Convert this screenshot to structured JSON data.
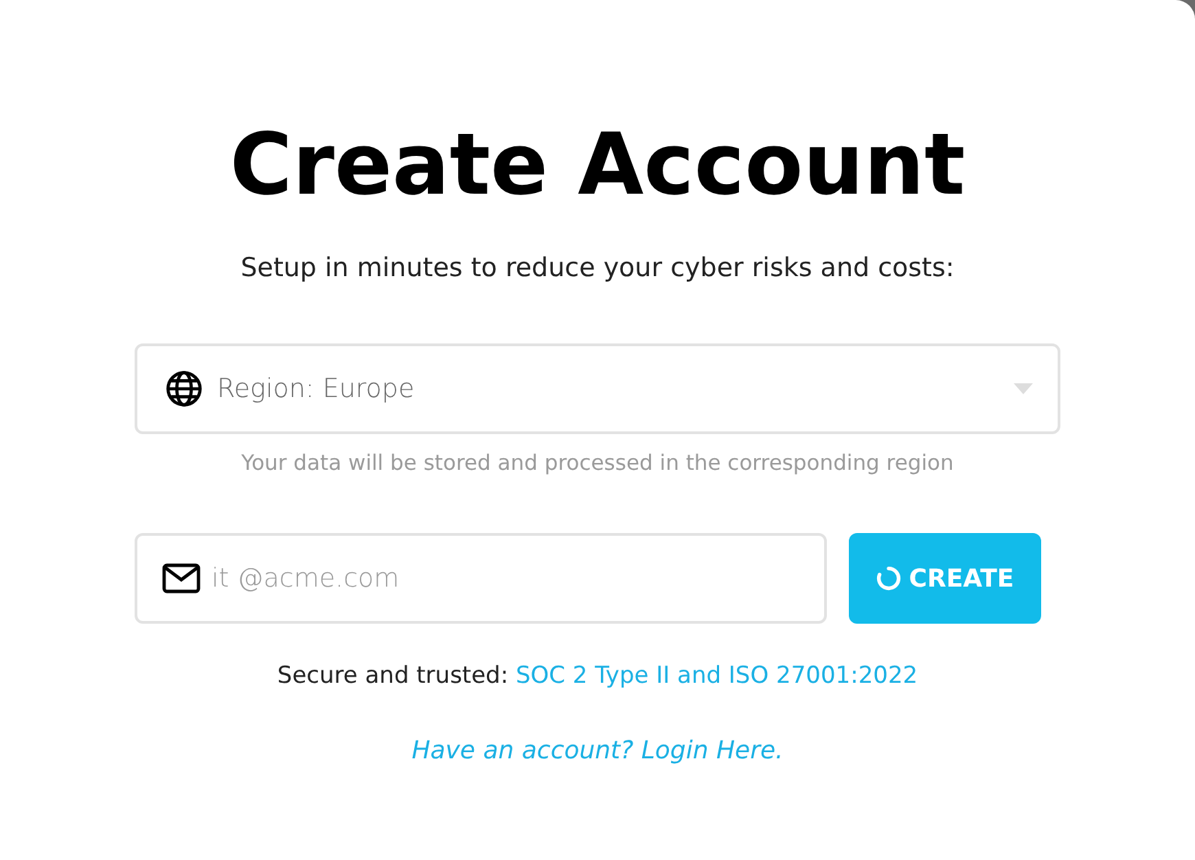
{
  "title": "Create Account",
  "subtitle": "Setup in minutes to reduce your cyber risks and costs:",
  "region_select": {
    "value": "Region: Europe"
  },
  "region_hint": "Your data will be stored and processed in the corresponding region",
  "email_field": {
    "placeholder": "it @acme.com"
  },
  "create_button": {
    "label": "CREATE",
    "loading": true
  },
  "trust_line": {
    "text": "Secure and trusted:",
    "link": "SOC 2 Type II and ISO 27001:2022"
  },
  "login_link": "Have an account? Login Here."
}
